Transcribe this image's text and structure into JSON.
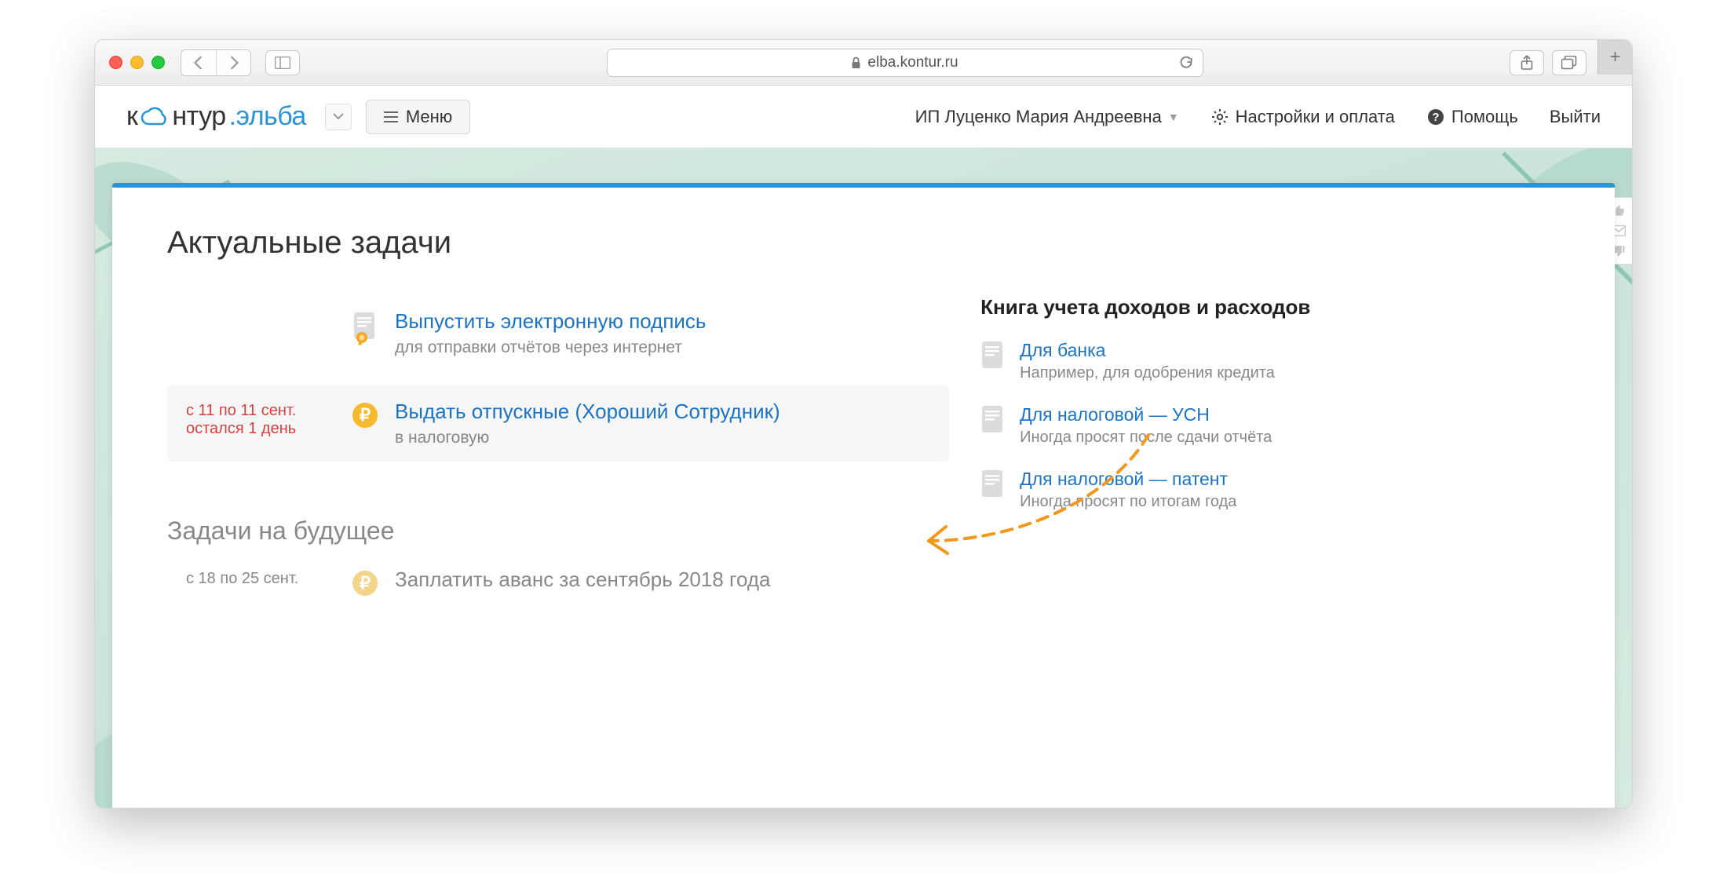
{
  "browser": {
    "url": "elba.kontur.ru"
  },
  "header": {
    "logo_part1": "к",
    "logo_part2": "нтур",
    "logo_elba": ".эльба",
    "menu_label": "Меню",
    "account_name": "ИП Луценко Мария Андреевна",
    "settings_label": "Настройки и оплата",
    "help_label": "Помощь",
    "logout_label": "Выйти"
  },
  "main": {
    "current_heading": "Актуальные задачи",
    "tasks": [
      {
        "date_line1": "",
        "date_line2": "",
        "title": "Выпустить электронную подпись",
        "subtitle": "для отправки отчётов через интернет",
        "icon": "doc-cert"
      },
      {
        "date_line1": "с 11 по 11 сент.",
        "date_line2": "остался 1 день",
        "title": "Выдать отпускные (Хороший Сотрудник)",
        "subtitle": "в налоговую",
        "icon": "ruble"
      }
    ],
    "future_heading": "Задачи на будущее",
    "future_tasks": [
      {
        "date_line1": "с 18 по 25 сент.",
        "title": "Заплатить аванс за сентябрь 2018 года",
        "icon": "ruble"
      }
    ]
  },
  "sidebar": {
    "heading": "Книга учета доходов и расходов",
    "items": [
      {
        "link": "Для банка",
        "sub": "Например, для одобрения кредита"
      },
      {
        "link": "Для налоговой — УСН",
        "sub": "Иногда просят после сдачи отчёта"
      },
      {
        "link": "Для налоговой — патент",
        "sub": "Иногда просят по итогам года"
      }
    ]
  }
}
